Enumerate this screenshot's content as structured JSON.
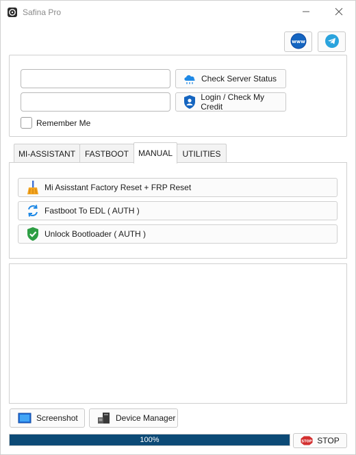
{
  "window": {
    "title": "Safina Pro",
    "app_icon": "safe-icon",
    "minimize_icon": "minimize-icon",
    "close_icon": "close-icon"
  },
  "top_buttons": {
    "www_icon": "globe-www-icon",
    "www_text": "www",
    "telegram_icon": "telegram-icon"
  },
  "login": {
    "username_value": "",
    "password_value": "",
    "check_server_label": "Check Server Status",
    "check_server_icon": "cloud-icon",
    "login_label": "Login / Check My Credit",
    "login_icon": "shield-user-icon",
    "remember_label": "Remember Me",
    "remember_checked": false
  },
  "tabs": [
    {
      "label": "MI-ASSISTANT",
      "active": false
    },
    {
      "label": "FASTBOOT",
      "active": false
    },
    {
      "label": "MANUAL",
      "active": true
    },
    {
      "label": "UTILITIES",
      "active": false
    }
  ],
  "functions": [
    {
      "label": "Mi Asisstant Factory Reset + FRP Reset",
      "icon": "broom-icon"
    },
    {
      "label": "Fastboot To EDL ( AUTH )",
      "icon": "refresh-icon"
    },
    {
      "label": "Unlock Bootloader ( AUTH )",
      "icon": "shield-check-icon"
    }
  ],
  "log": {
    "content": ""
  },
  "bottom": {
    "screenshot_label": "Screenshot",
    "screenshot_icon": "screen-icon",
    "device_manager_label": "Device Manager",
    "device_manager_icon": "device-manager-icon",
    "progress_value": 100,
    "progress_text": "100%",
    "stop_label": "STOP",
    "stop_icon_text": "STOP",
    "stop_icon": "stop-sign-icon"
  },
  "colors": {
    "progress_fill": "#0c4a76",
    "accent_blue": "#1e88e5",
    "stop_red": "#d32f2f"
  }
}
